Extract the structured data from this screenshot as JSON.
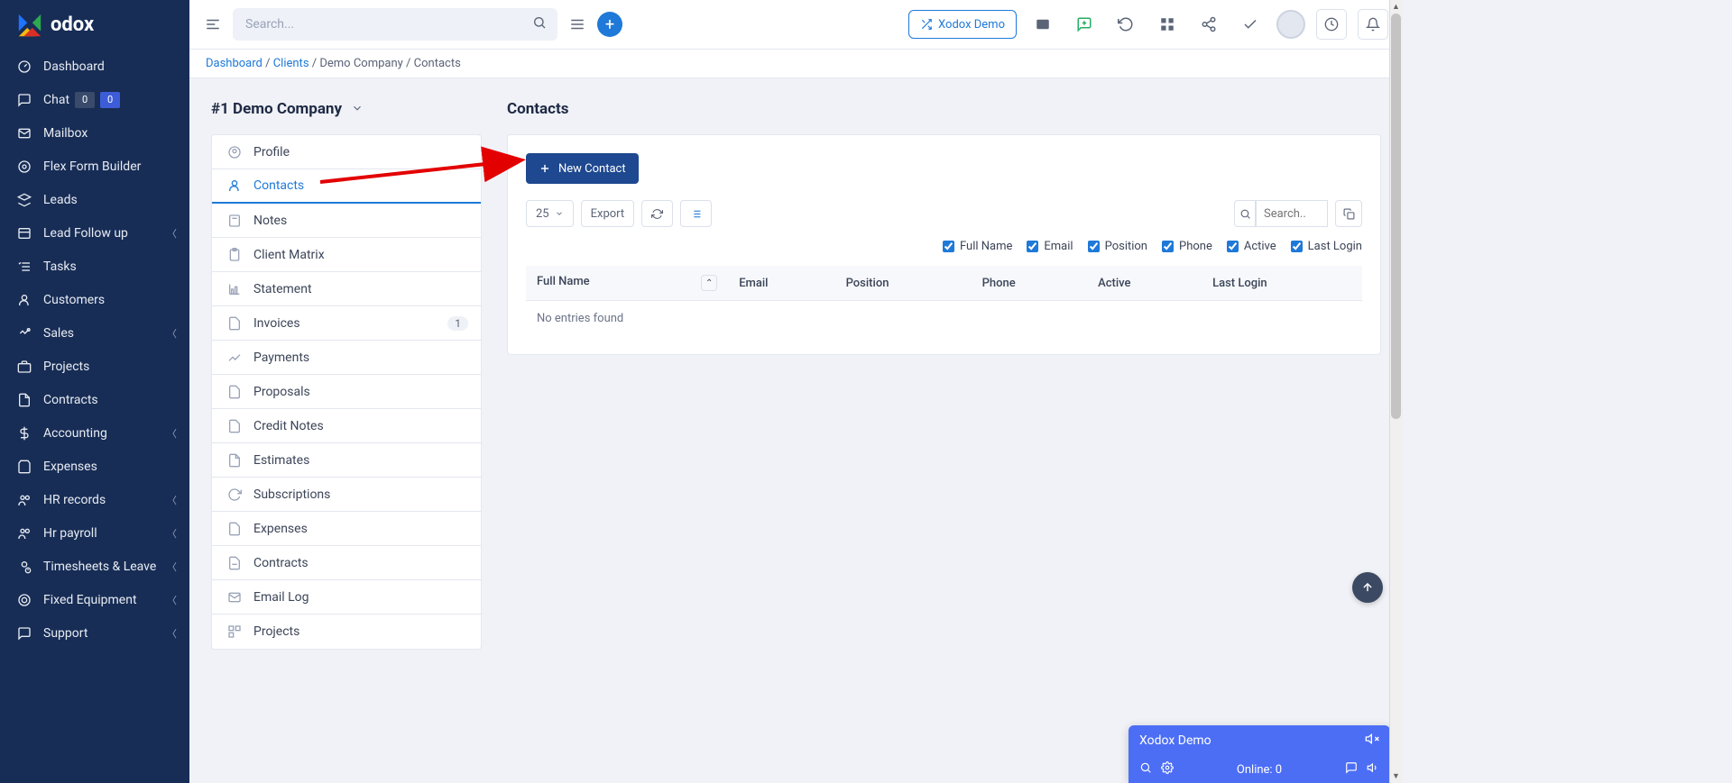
{
  "brand": "odox",
  "topbar": {
    "search_placeholder": "Search...",
    "demo_button": "Xodox Demo"
  },
  "sidebar": [
    {
      "icon": "gauge",
      "label": "Dashboard",
      "chev": false
    },
    {
      "icon": "chat",
      "label": "Chat",
      "chev": false,
      "badges": [
        "0",
        "0"
      ]
    },
    {
      "icon": "mail",
      "label": "Mailbox",
      "chev": false
    },
    {
      "icon": "gears",
      "label": "Flex Form Builder",
      "chev": false
    },
    {
      "icon": "layers",
      "label": "Leads",
      "chev": false
    },
    {
      "icon": "followup",
      "label": "Lead Follow up",
      "chev": true
    },
    {
      "icon": "tasks",
      "label": "Tasks",
      "chev": false
    },
    {
      "icon": "user",
      "label": "Customers",
      "chev": false
    },
    {
      "icon": "hand",
      "label": "Sales",
      "chev": true
    },
    {
      "icon": "briefcase",
      "label": "Projects",
      "chev": false
    },
    {
      "icon": "doc",
      "label": "Contracts",
      "chev": false
    },
    {
      "icon": "dollar",
      "label": "Accounting",
      "chev": true
    },
    {
      "icon": "bag",
      "label": "Expenses",
      "chev": false
    },
    {
      "icon": "people",
      "label": "HR records",
      "chev": true
    },
    {
      "icon": "people",
      "label": "Hr payroll",
      "chev": true
    },
    {
      "icon": "userclock",
      "label": "Timesheets & Leave",
      "chev": true
    },
    {
      "icon": "target",
      "label": "Fixed Equipment",
      "chev": true
    },
    {
      "icon": "chat",
      "label": "Support",
      "chev": true
    }
  ],
  "breadcrumb": {
    "dashboard": "Dashboard",
    "clients": "Clients",
    "company": "Demo Company",
    "section": "Contacts"
  },
  "page": {
    "title": "#1 Demo Company",
    "section": "Contacts",
    "new_contact": "New Contact",
    "page_size": "25",
    "export_label": "Export",
    "table_search_placeholder": "Search..",
    "no_entries": "No entries found"
  },
  "tabs": [
    {
      "icon": "usercircle",
      "label": "Profile"
    },
    {
      "icon": "user",
      "label": "Contacts",
      "active": true
    },
    {
      "icon": "note",
      "label": "Notes"
    },
    {
      "icon": "clipboard",
      "label": "Client Matrix"
    },
    {
      "icon": "chart",
      "label": "Statement"
    },
    {
      "icon": "file",
      "label": "Invoices",
      "count": "1"
    },
    {
      "icon": "trend",
      "label": "Payments"
    },
    {
      "icon": "file",
      "label": "Proposals"
    },
    {
      "icon": "file",
      "label": "Credit Notes"
    },
    {
      "icon": "fileo",
      "label": "Estimates"
    },
    {
      "icon": "refresh",
      "label": "Subscriptions"
    },
    {
      "icon": "file",
      "label": "Expenses"
    },
    {
      "icon": "filestack",
      "label": "Contracts"
    },
    {
      "icon": "envelope",
      "label": "Email Log"
    },
    {
      "icon": "grid",
      "label": "Projects"
    }
  ],
  "column_filters": [
    {
      "label": "Full Name",
      "checked": true
    },
    {
      "label": "Email",
      "checked": true
    },
    {
      "label": "Position",
      "checked": true
    },
    {
      "label": "Phone",
      "checked": true
    },
    {
      "label": "Active",
      "checked": true
    },
    {
      "label": "Last Login",
      "checked": true
    }
  ],
  "columns": [
    "Full Name",
    "Email",
    "Position",
    "Phone",
    "Active",
    "Last Login"
  ],
  "chat": {
    "title": "Xodox Demo",
    "online": "Online: 0"
  }
}
